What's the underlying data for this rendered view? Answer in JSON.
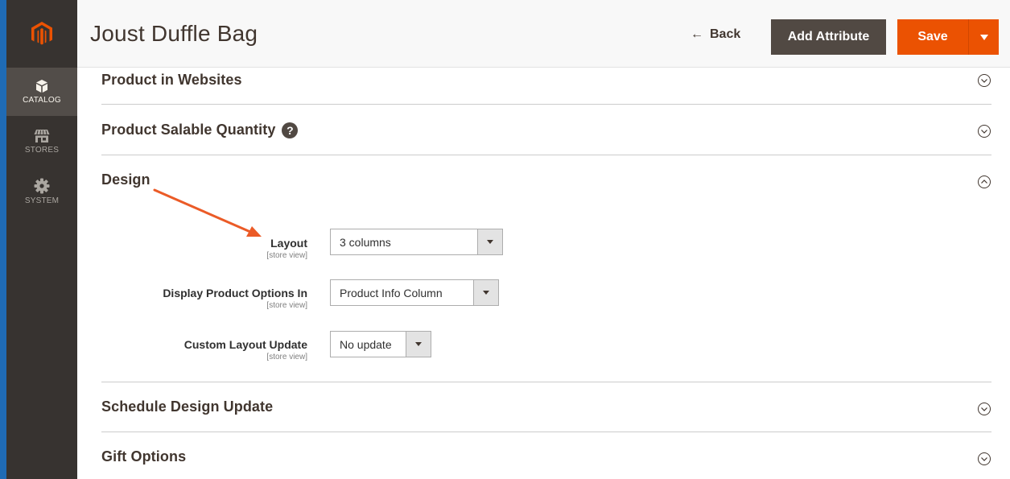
{
  "app": {
    "nav": [
      {
        "label": "CATALOG",
        "icon": "cube-icon",
        "active": true
      },
      {
        "label": "STORES",
        "icon": "storefront-icon",
        "active": false
      },
      {
        "label": "SYSTEM",
        "icon": "gear-icon",
        "active": false
      }
    ]
  },
  "header": {
    "title": "Joust Duffle Bag",
    "back_label": "Back",
    "add_attribute_label": "Add Attribute",
    "save_label": "Save"
  },
  "sections": {
    "websites": {
      "title": "Product in Websites"
    },
    "salable": {
      "title": "Product Salable Quantity",
      "help": "?"
    },
    "design": {
      "title": "Design",
      "fields": [
        {
          "label": "Layout",
          "scope": "[store view]",
          "value": "3 columns"
        },
        {
          "label": "Display Product Options In",
          "scope": "[store view]",
          "value": "Product Info Column"
        },
        {
          "label": "Custom Layout Update",
          "scope": "[store view]",
          "value": "No update"
        }
      ]
    },
    "schedule": {
      "title": "Schedule Design Update"
    },
    "gift": {
      "title": "Gift Options"
    }
  },
  "colors": {
    "accent": "#eb5202",
    "sidebar": "#373330",
    "dark_button": "#514943",
    "annotation": "#eb5b27"
  }
}
